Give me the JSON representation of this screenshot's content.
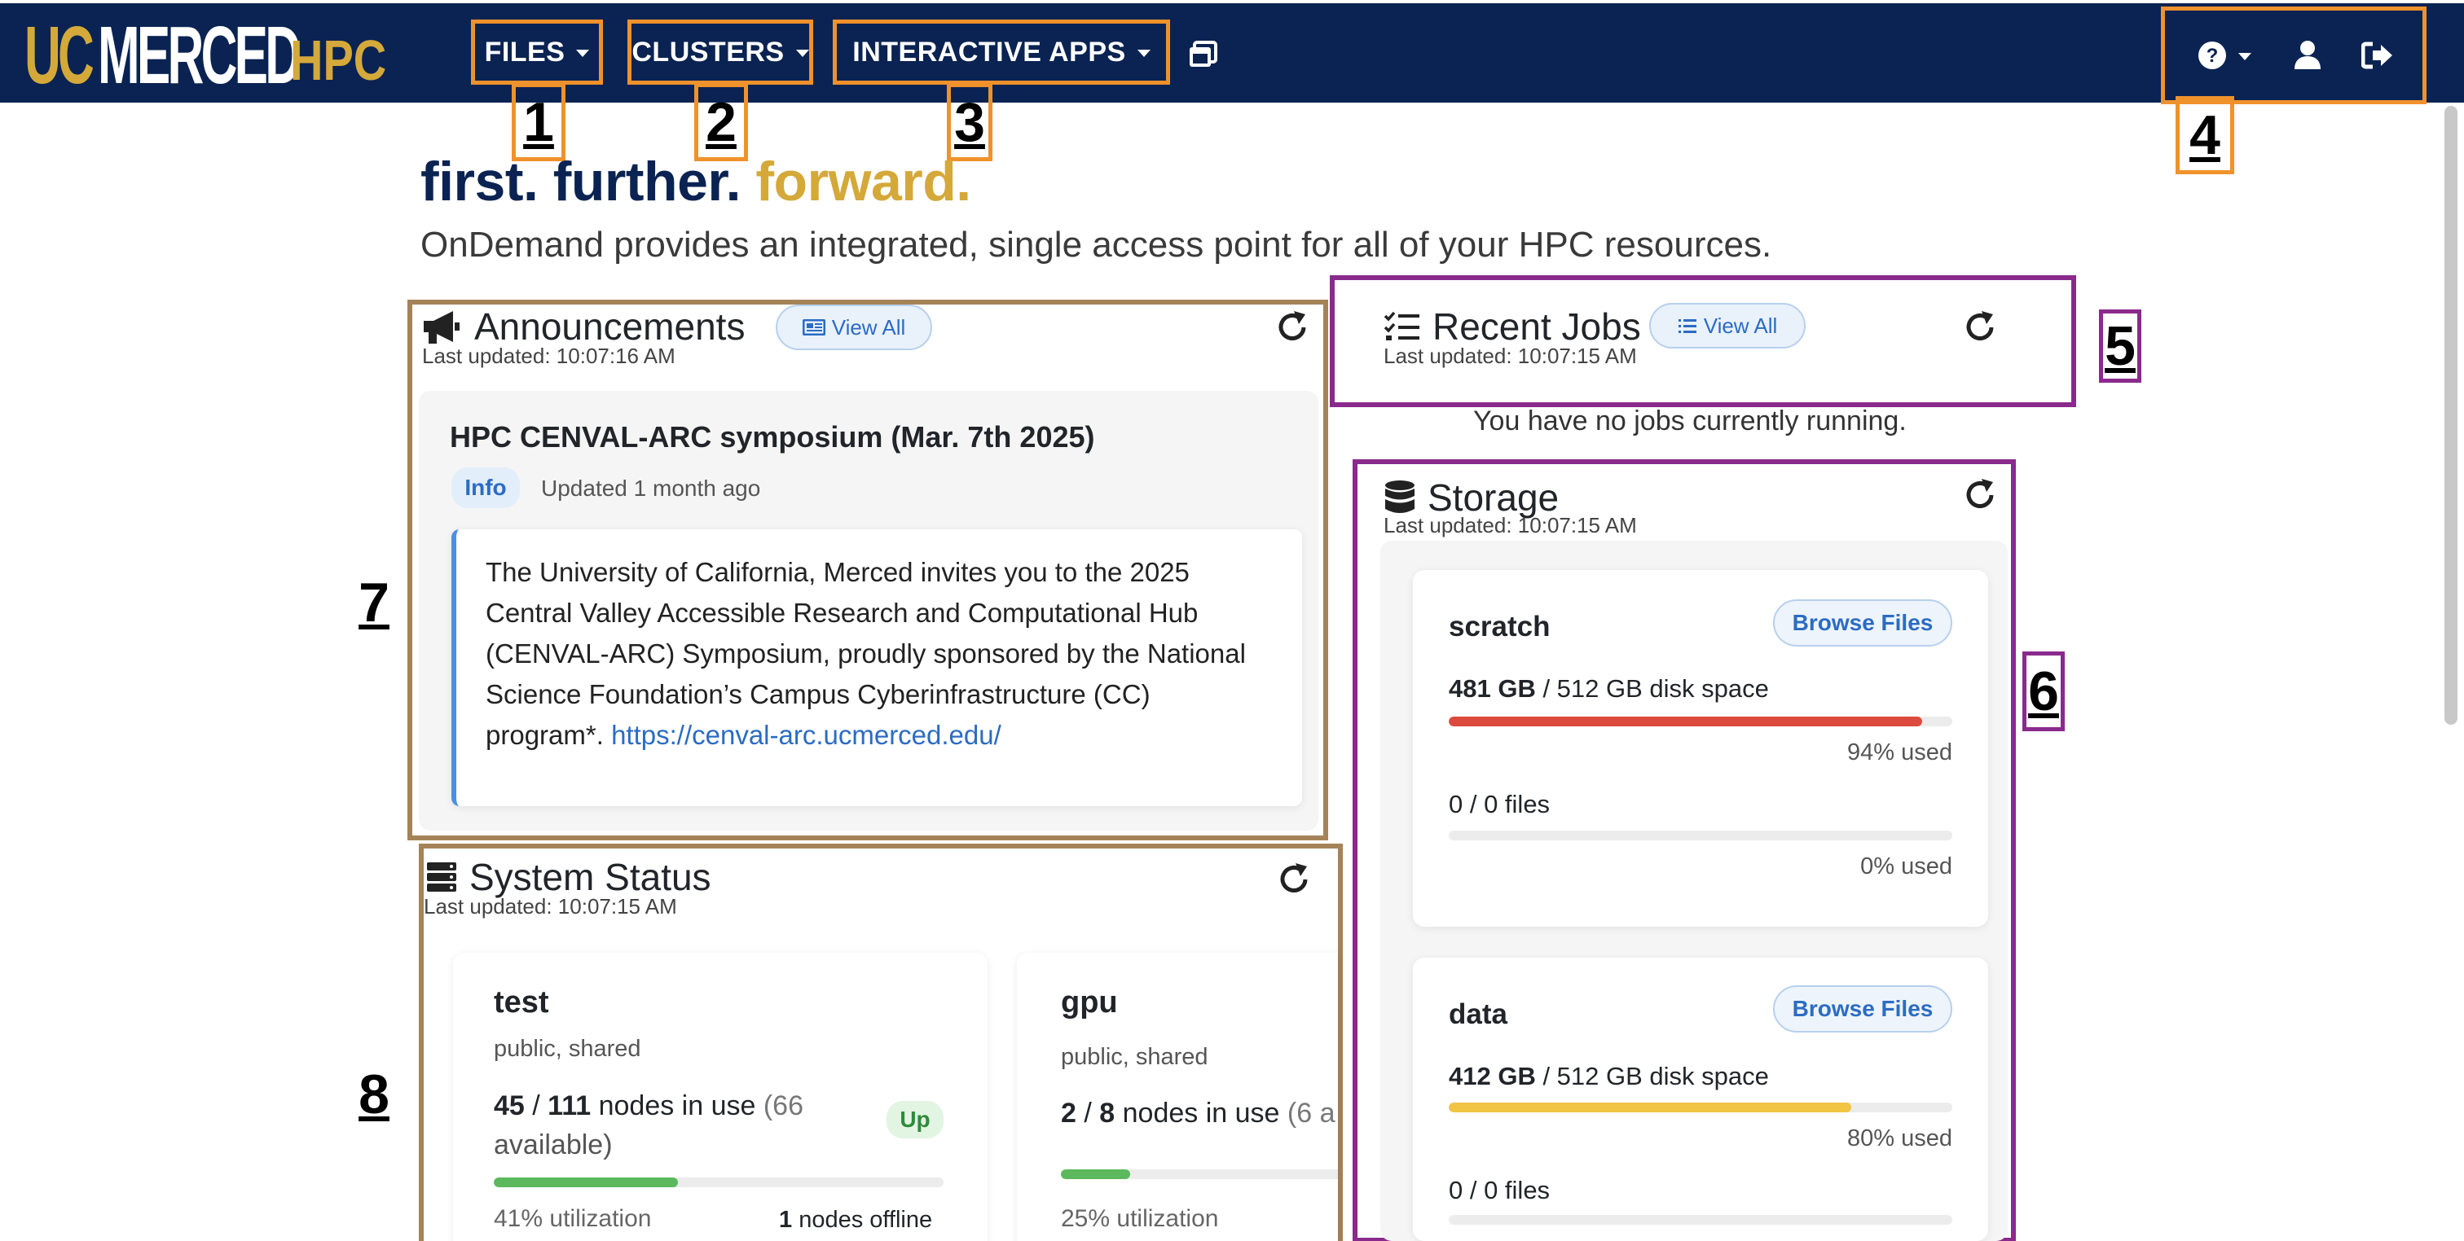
{
  "colors": {
    "navbar": "#0a2352",
    "gold": "#d4a93a",
    "orange_marker": "#f0922b",
    "purple_marker": "#8a2a8c",
    "brown_marker": "#a58358",
    "link": "#2b6cc4",
    "bar_red": "#dc4a3d",
    "bar_yellow": "#f2c443",
    "bar_green": "#5cb85c"
  },
  "brand": {
    "uc": "UC",
    "merced": "MERCED",
    "hpc": "HPC"
  },
  "nav": {
    "files": "FILES",
    "clusters": "CLUSTERS",
    "interactive_apps": "INTERACTIVE APPS",
    "sessions_icon": "windows-stack-icon",
    "help_icon": "question-circle-icon",
    "user_icon": "user-icon",
    "logout_icon": "sign-out-icon"
  },
  "markers": [
    "1",
    "2",
    "3",
    "4",
    "5",
    "6",
    "7",
    "8"
  ],
  "tagline": {
    "part1": "first. further.",
    "part2": "forward."
  },
  "subtitle": "OnDemand provides an integrated, single access point for all of your HPC resources.",
  "announcements": {
    "title": "Announcements",
    "view_all": "View All",
    "last_updated": "Last updated: 10:07:16 AM",
    "item": {
      "title": "HPC CENVAL-ARC symposium (Mar. 7th 2025)",
      "badge": "Info",
      "updated": "Updated 1 month ago",
      "body_lines": [
        "The University of California, Merced invites you to the 2025",
        "Central Valley Accessible Research and Computational Hub",
        "(CENVAL-ARC) Symposium, proudly sponsored by the National",
        "Science Foundation’s Campus Cyberinfrastructure (CC)"
      ],
      "body_last_prefix": "program*. ",
      "link": "https://cenval-arc.ucmerced.edu/"
    }
  },
  "recent_jobs": {
    "title": "Recent Jobs",
    "view_all": "View All",
    "last_updated": "Last updated: 10:07:15 AM",
    "empty": "You have no jobs currently running."
  },
  "storage": {
    "title": "Storage",
    "last_updated": "Last updated: 10:07:15 AM",
    "items": [
      {
        "name": "scratch",
        "browse": "Browse Files",
        "used": "481 GB",
        "total": " / 512 GB disk space",
        "pct_text": "94% used",
        "pct": 0.94,
        "files": "0 / 0 files",
        "files_pct_text": "0% used",
        "files_pct": 0
      },
      {
        "name": "data",
        "browse": "Browse Files",
        "used": "412 GB",
        "total": " / 512 GB disk space",
        "pct_text": "80% used",
        "pct": 0.8,
        "files": "0 / 0 files"
      }
    ]
  },
  "system_status": {
    "title": "System Status",
    "last_updated": "Last updated: 10:07:15 AM",
    "clusters": [
      {
        "name": "test",
        "tags": "public, shared",
        "used": "45",
        "total": "111",
        "nodes_label": " nodes in use ",
        "avail_line1": "(66",
        "avail_line2": "available)",
        "badge": "Up",
        "util_text": "41% utilization",
        "util": 0.41,
        "offline_count": "1",
        "offline_label": " nodes offline"
      },
      {
        "name": "gpu",
        "tags": "public, shared",
        "used": "2",
        "total": "8",
        "nodes_label": " nodes in use ",
        "avail_line1": "(6 a",
        "util_text": "25% utilization",
        "util": 0.25
      }
    ]
  }
}
